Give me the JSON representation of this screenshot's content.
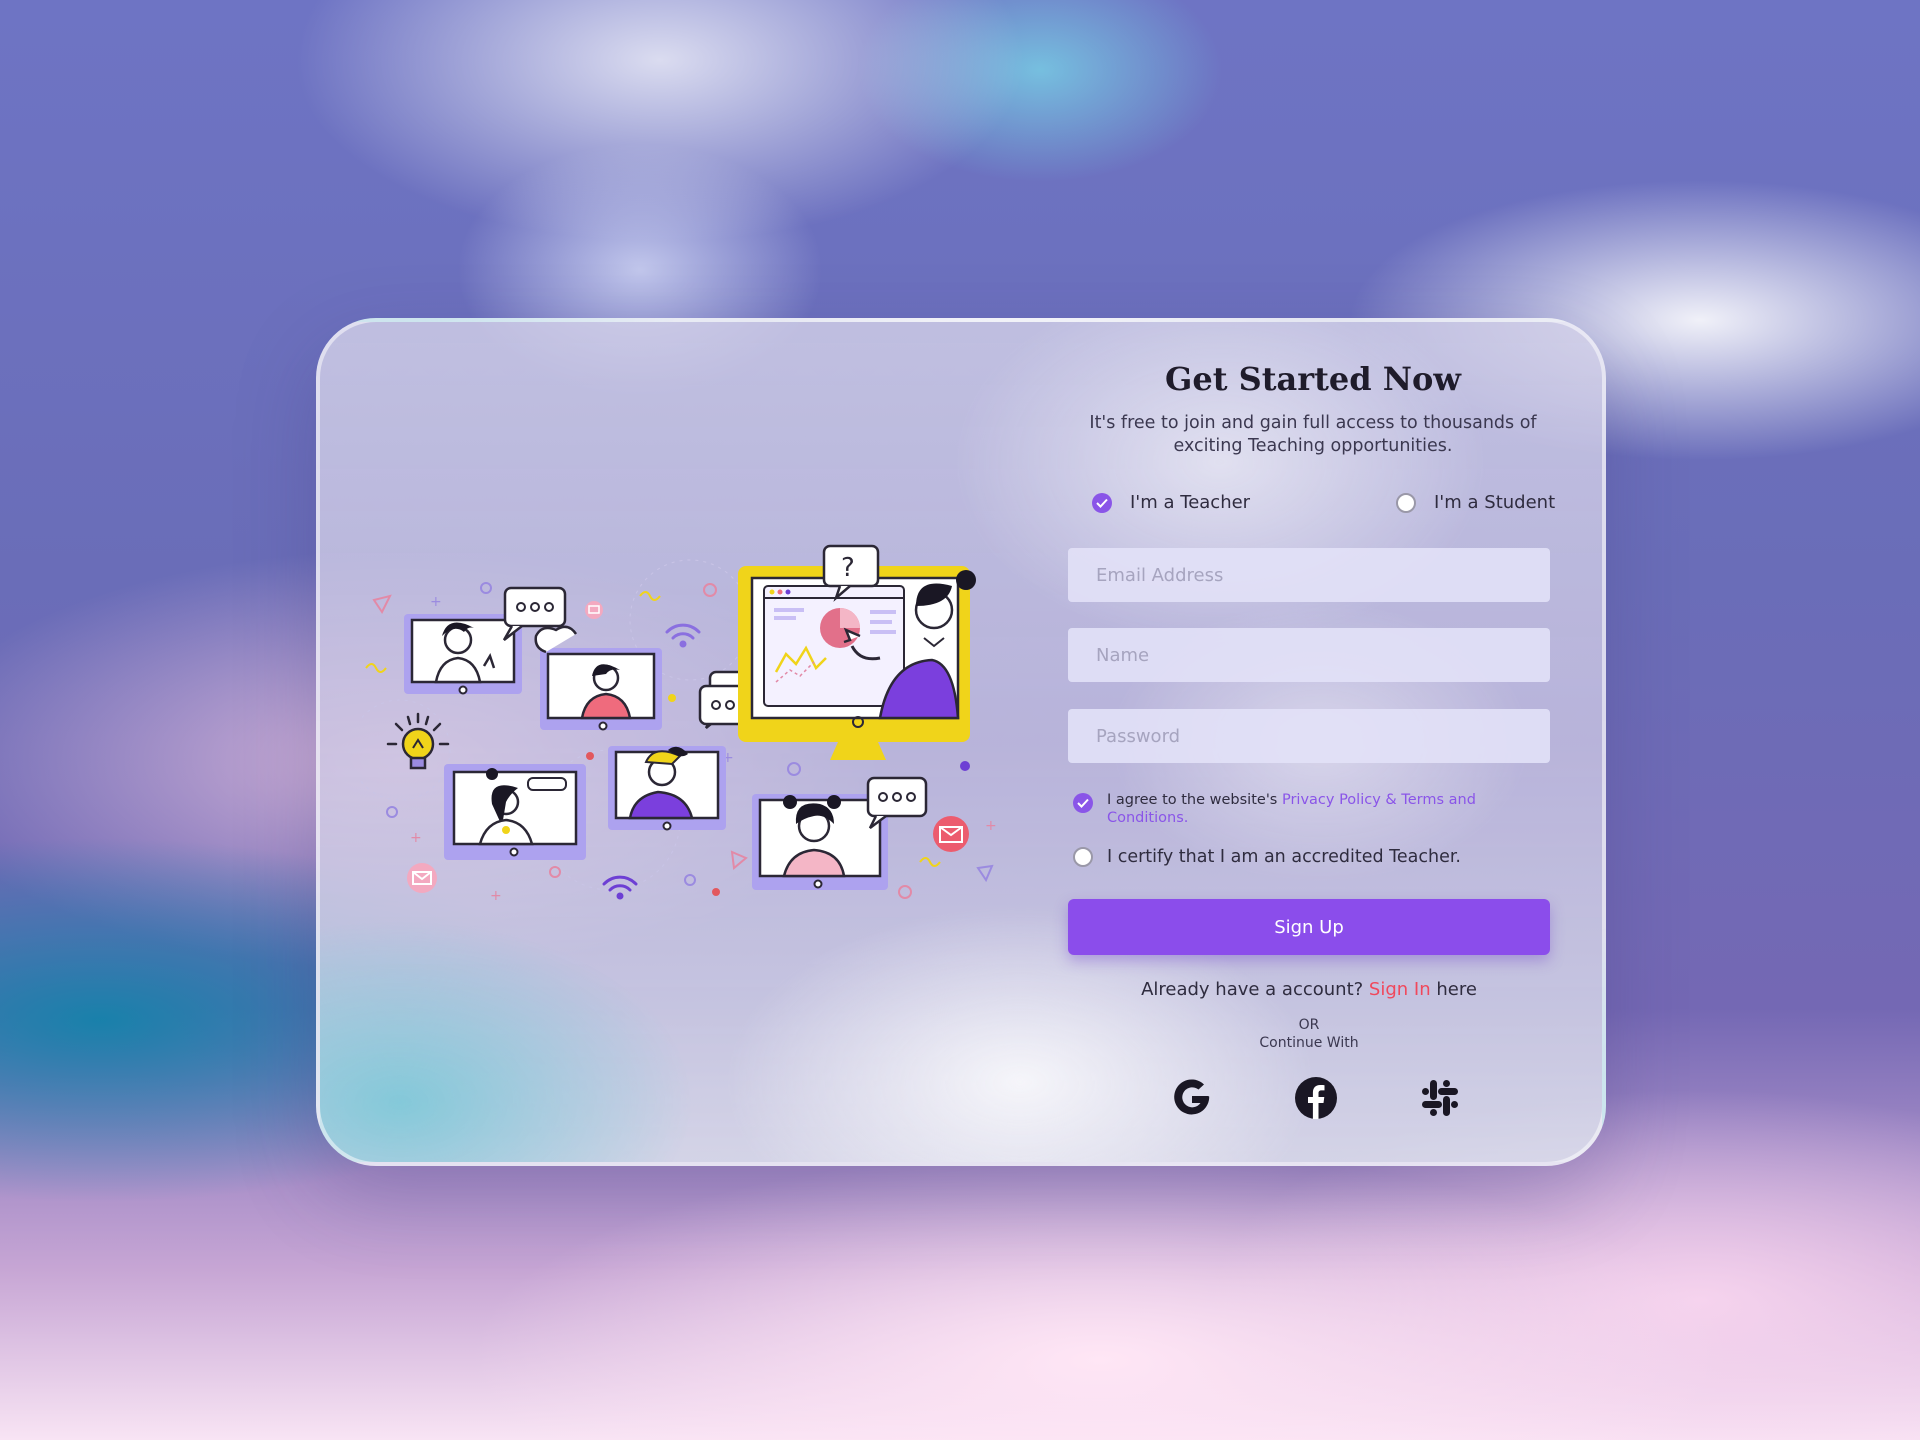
{
  "form": {
    "title": "Get Started Now",
    "subtitle": "It's free to join and gain full access to thousands of exciting Teaching opportunities.",
    "roles": {
      "teacher_label": "I'm a Teacher",
      "teacher_selected": true,
      "student_label": "I'm a Student",
      "student_selected": false
    },
    "fields": {
      "email_placeholder": "Email Address",
      "name_placeholder": "Name",
      "password_placeholder": "Password"
    },
    "agree": {
      "prefix": "I agree to the website's ",
      "link": "Privacy Policy & Terms and Conditions.",
      "checked": true
    },
    "certify": {
      "label": "I certify that I am an accredited Teacher.",
      "checked": false
    },
    "signup_label": "Sign Up",
    "already": {
      "prefix": "Already have a account? ",
      "link": "Sign In",
      "suffix": " here"
    },
    "or_label": "OR",
    "continue_label": "Continue With",
    "socials": [
      "google-icon",
      "facebook-icon",
      "slack-icon"
    ]
  },
  "colors": {
    "accent": "#8b4deb",
    "link_red": "#f0485c",
    "input_bg": "#e2e1f7",
    "illustration_yellow": "#f0d41a",
    "illustration_purple": "#a99cf0"
  },
  "illustration": {
    "type": "online-teaching-illustration"
  }
}
